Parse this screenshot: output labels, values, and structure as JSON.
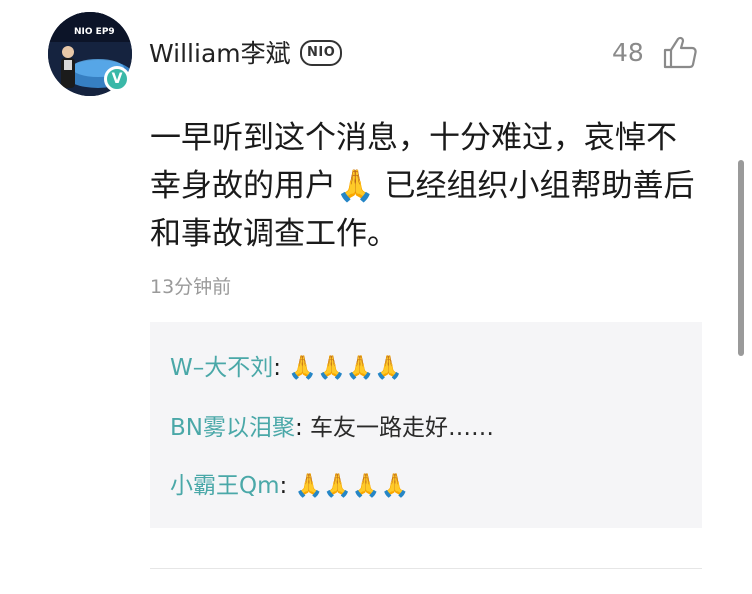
{
  "comment": {
    "username": "William李斌",
    "brand_badge": "NIO",
    "avatar_badge": "V",
    "like_count": "48",
    "body": "一早听到这个消息，十分难过，哀悼不幸身故的用户🙏 已经组织小组帮助善后和事故调查工作。",
    "timestamp": "13分钟前",
    "icons": {
      "like": "thumbs-up-icon",
      "verified": "verified-badge-icon"
    }
  },
  "replies": [
    {
      "author": "W–大不刘",
      "text": "🙏🙏🙏🙏"
    },
    {
      "author": "BN雾以泪聚",
      "text": "车友一路走好……"
    },
    {
      "author": "小霸王Qm",
      "text": "🙏🙏🙏🙏"
    }
  ],
  "colors": {
    "reply_author": "#4aa8a8",
    "verified_badge": "#3ab8a8",
    "reply_panel_bg": "#f5f5f7",
    "meta_gray": "#9a9a9a"
  }
}
